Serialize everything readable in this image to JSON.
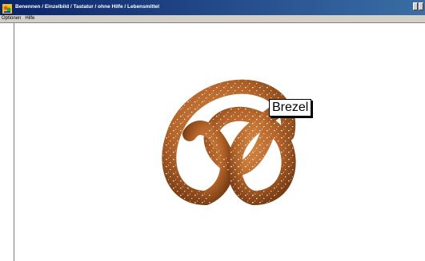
{
  "window": {
    "title": "Benennen / Einzelbild / Tastatur / ohne Hilfe / Lebensmittel",
    "icon": "app-icon"
  },
  "menu": {
    "items": [
      "Optionen",
      "Hilfe"
    ]
  },
  "content": {
    "image": "pretzel",
    "label": "Brezel"
  },
  "colors": {
    "titlebar_start": "#0a246a",
    "titlebar_end": "#3a6ea5",
    "pretzel": "#b5652a"
  }
}
